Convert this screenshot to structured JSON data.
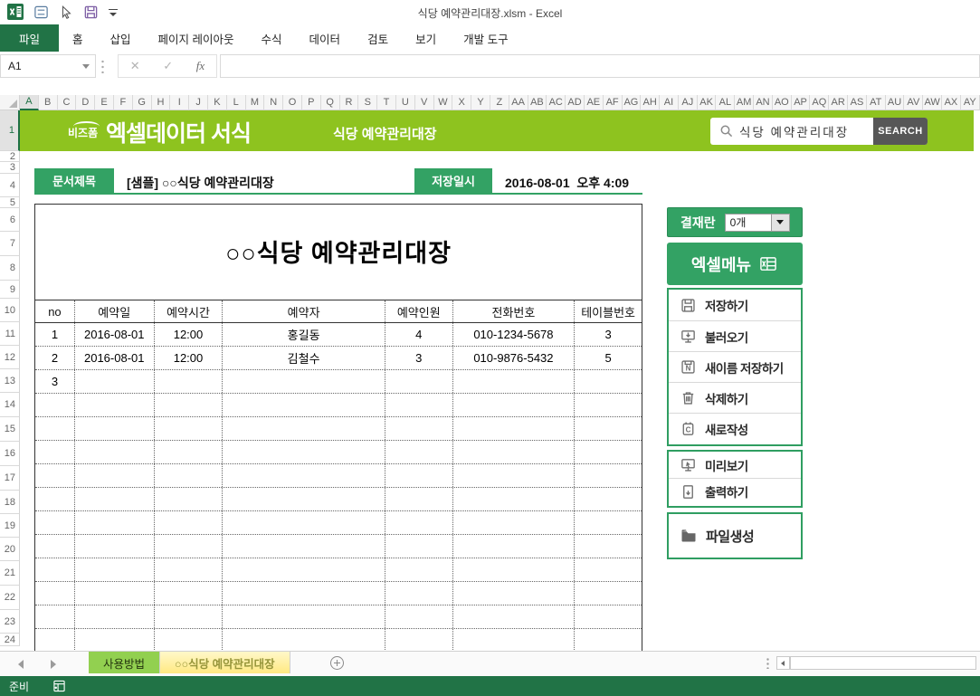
{
  "title_bar": {
    "title": "식당 예약관리대장.xlsm - Excel",
    "quick_access_icons": [
      "excel-logo-icon",
      "touch-mode-icon",
      "cursor-icon",
      "save-icon",
      "customize-toolbar-icon"
    ]
  },
  "ribbon": {
    "tabs": [
      {
        "label": "파일",
        "active": true
      },
      {
        "label": "홈"
      },
      {
        "label": "삽입"
      },
      {
        "label": "페이지 레이아웃"
      },
      {
        "label": "수식"
      },
      {
        "label": "데이터"
      },
      {
        "label": "검토"
      },
      {
        "label": "보기"
      },
      {
        "label": "개발 도구"
      }
    ]
  },
  "formula_bar": {
    "name_box": "A1",
    "cancel_glyph": "✕",
    "enter_glyph": "✓",
    "fx_glyph": "fx",
    "value": ""
  },
  "grid": {
    "columns": [
      "A",
      "B",
      "C",
      "D",
      "E",
      "F",
      "G",
      "H",
      "I",
      "J",
      "K",
      "L",
      "M",
      "N",
      "O",
      "P",
      "Q",
      "R",
      "S",
      "T",
      "U",
      "V",
      "W",
      "X",
      "Y",
      "Z",
      "AA",
      "AB",
      "AC",
      "AD",
      "AE",
      "AF",
      "AG",
      "AH",
      "AI",
      "AJ",
      "AK",
      "AL",
      "AM",
      "AN",
      "AO",
      "AP",
      "AQ",
      "AR",
      "AS",
      "AT",
      "AU",
      "AV",
      "AW",
      "AX",
      "AY"
    ],
    "rows": [
      "1",
      "2",
      "3",
      "4",
      "5",
      "6",
      "7",
      "8",
      "9",
      "10",
      "11",
      "12",
      "13",
      "14",
      "15",
      "16",
      "17",
      "18",
      "19",
      "20",
      "21",
      "22",
      "23",
      "24"
    ],
    "selected_column": "A",
    "selected_row": "1"
  },
  "header_band": {
    "logo": "비즈폼",
    "brand": "엑셀데이터 서식",
    "doc_type": "식당 예약관리대장",
    "search": {
      "value": "식당 예약관리대장",
      "button_label": "SEARCH"
    }
  },
  "doc_info": {
    "doc_title_label": "문서제목",
    "doc_title": "[샘플] ○○식당 예약관리대장",
    "saved_label": "저장일시",
    "saved_value": "2016-08-01  오후 4:09"
  },
  "sheet": {
    "form_title": "○○식당 예약관리대장",
    "table": {
      "headers": [
        "no",
        "예약일",
        "예약시간",
        "예약자",
        "예약인원",
        "전화번호",
        "테이블번호"
      ],
      "rows": [
        [
          "1",
          "2016-08-01",
          "12:00",
          "홍길동",
          "4",
          "010-1234-5678",
          "3"
        ],
        [
          "2",
          "2016-08-01",
          "12:00",
          "김철수",
          "3",
          "010-9876-5432",
          "5"
        ],
        [
          "3",
          "",
          "",
          "",
          "",
          "",
          ""
        ]
      ],
      "empty_row_count": 11
    }
  },
  "approval": {
    "label": "결재란",
    "value": "0개"
  },
  "excel_menu": {
    "title": "엑셀메뉴",
    "title_icon": "excel-logo-icon",
    "groups": [
      {
        "items": [
          {
            "icon": "save-icon",
            "label": "저장하기"
          },
          {
            "icon": "load-icon",
            "label": "불러오기"
          },
          {
            "icon": "save-as-icon",
            "label": "새이름 저장하기"
          },
          {
            "icon": "delete-icon",
            "label": "삭제하기"
          },
          {
            "icon": "new-doc-icon",
            "label": "새로작성"
          }
        ]
      },
      {
        "items": [
          {
            "icon": "preview-icon",
            "label": "미리보기"
          },
          {
            "icon": "print-icon",
            "label": "출력하기"
          }
        ]
      },
      {
        "items": [
          {
            "icon": "folder-icon",
            "label": "파일생성"
          }
        ]
      }
    ]
  },
  "sheet_tabs": {
    "tabs": [
      {
        "label": "사용방법",
        "color": "green",
        "active": false
      },
      {
        "label": "○○식당 예약관리대장",
        "color": "yellow",
        "active": true
      }
    ]
  },
  "status_bar": {
    "status": "준비"
  },
  "colors": {
    "band_green": "#8ec31f",
    "accent_green": "#33a264",
    "dark_green": "#217346",
    "search_button_gray": "#575757",
    "tab_green": "#92d050",
    "tab_yellow": "#ffe982"
  }
}
